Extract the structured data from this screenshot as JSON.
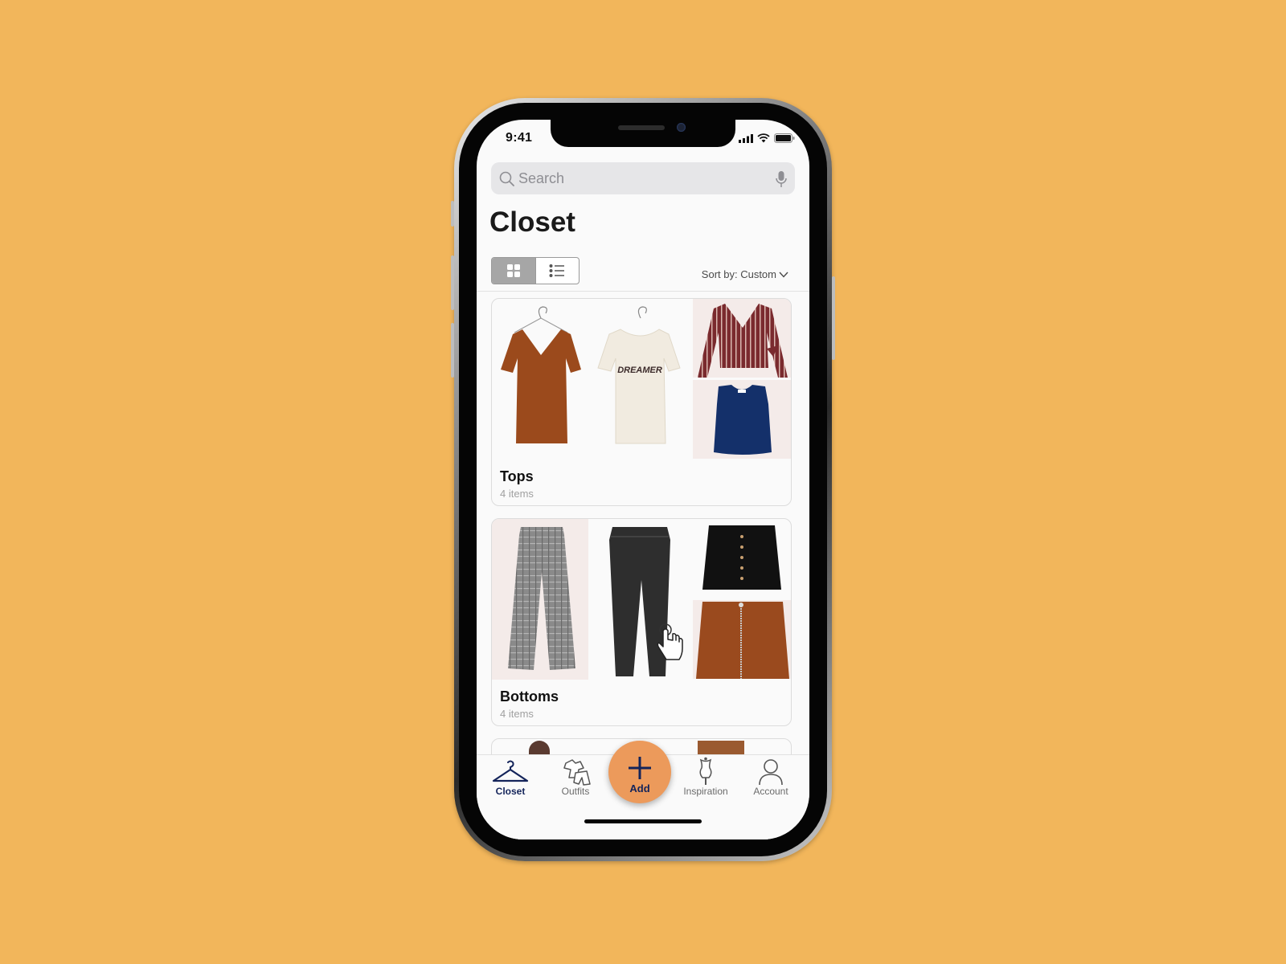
{
  "status_bar": {
    "time": "9:41"
  },
  "search": {
    "placeholder": "Search"
  },
  "page": {
    "title": "Closet"
  },
  "view_toggle": {
    "grid_label": "Grid view",
    "list_label": "List view",
    "active": "grid"
  },
  "sort": {
    "label": "Sort by: Custom"
  },
  "categories": [
    {
      "name": "Tops",
      "count": "4 items",
      "items": [
        {
          "desc": "Rust V-neck tee",
          "color": "#9b4a1c"
        },
        {
          "desc": "Cream DREAMER tee",
          "color": "#f1ebe0",
          "print": "DREAMER"
        },
        {
          "desc": "Striped wrap blouse",
          "color": "#7a2a2e"
        },
        {
          "desc": "Navy tank top",
          "color": "#14306a"
        }
      ]
    },
    {
      "name": "Bottoms",
      "count": "4 items",
      "items": [
        {
          "desc": "Grey plaid trousers",
          "color": "#8a8a8a"
        },
        {
          "desc": "Black skinny jeans",
          "color": "#2e2e2e"
        },
        {
          "desc": "Black button mini skirt",
          "color": "#111111"
        },
        {
          "desc": "Rust suede zip skirt",
          "color": "#9a4a1e"
        }
      ]
    }
  ],
  "tab_bar": {
    "tabs": [
      {
        "label": "Closet",
        "icon": "hanger-icon",
        "active": true
      },
      {
        "label": "Outfits",
        "icon": "outfits-icon",
        "active": false
      },
      {
        "label": "Add",
        "icon": "plus-icon",
        "active": false
      },
      {
        "label": "Inspiration",
        "icon": "mannequin-icon",
        "active": false
      },
      {
        "label": "Account",
        "icon": "person-icon",
        "active": false
      }
    ]
  },
  "colors": {
    "background": "#F2B65B",
    "accent": "#EC9A5B",
    "active_tab": "#14245a"
  }
}
